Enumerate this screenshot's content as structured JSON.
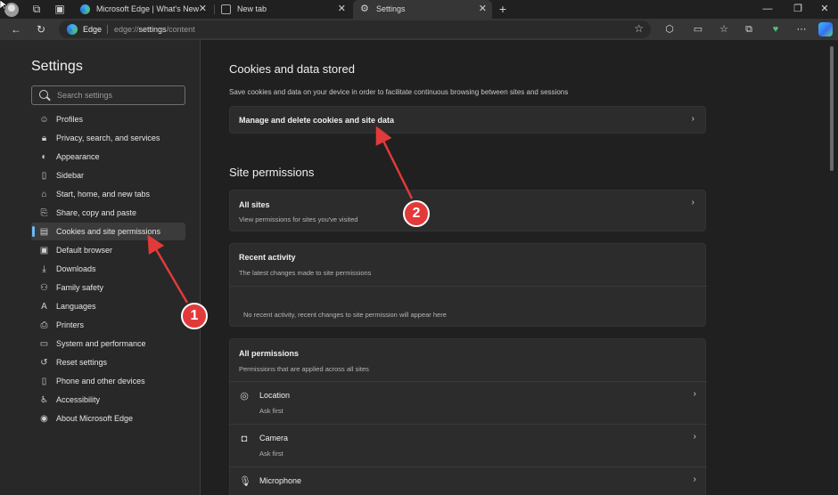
{
  "tabs": [
    {
      "title": "Microsoft Edge | What's New"
    },
    {
      "title": "New tab"
    },
    {
      "title": "Settings"
    }
  ],
  "address": {
    "brand": "Edge",
    "url_prefix": "edge://",
    "url_path": "settings",
    "url_suffix": "/content"
  },
  "sidebar": {
    "title": "Settings",
    "search_placeholder": "Search settings",
    "items": [
      {
        "label": "Profiles",
        "icon": "person-icon"
      },
      {
        "label": "Privacy, search, and services",
        "icon": "lock-icon"
      },
      {
        "label": "Appearance",
        "icon": "paint-icon"
      },
      {
        "label": "Sidebar",
        "icon": "sidebar-icon"
      },
      {
        "label": "Start, home, and new tabs",
        "icon": "home-icon"
      },
      {
        "label": "Share, copy and paste",
        "icon": "share-icon"
      },
      {
        "label": "Cookies and site permissions",
        "icon": "cookie-icon"
      },
      {
        "label": "Default browser",
        "icon": "browser-icon"
      },
      {
        "label": "Downloads",
        "icon": "download-icon"
      },
      {
        "label": "Family safety",
        "icon": "family-icon"
      },
      {
        "label": "Languages",
        "icon": "language-icon"
      },
      {
        "label": "Printers",
        "icon": "printer-icon"
      },
      {
        "label": "System and performance",
        "icon": "laptop-icon"
      },
      {
        "label": "Reset settings",
        "icon": "reset-icon"
      },
      {
        "label": "Phone and other devices",
        "icon": "phone-icon"
      },
      {
        "label": "Accessibility",
        "icon": "accessibility-icon"
      },
      {
        "label": "About Microsoft Edge",
        "icon": "edge-icon"
      }
    ],
    "active_index": 6
  },
  "main": {
    "cookies": {
      "heading": "Cookies and data stored",
      "description": "Save cookies and data on your device in order to facilitate continuous browsing between sites and sessions",
      "manage_label": "Manage and delete cookies and site data"
    },
    "permissions": {
      "heading": "Site permissions",
      "all_sites_title": "All sites",
      "all_sites_sub": "View permissions for sites you've visited",
      "recent_title": "Recent activity",
      "recent_sub": "The latest changes made to site permissions",
      "recent_empty": "No recent activity, recent changes to site permission will appear here",
      "all_perms_title": "All permissions",
      "all_perms_sub": "Permissions that are applied across all sites",
      "location_title": "Location",
      "location_sub": "Ask first",
      "camera_title": "Camera",
      "camera_sub": "Ask first",
      "microphone_title": "Microphone"
    }
  },
  "annotations": {
    "badge1": "1",
    "badge2": "2",
    "color": "#e23a3a"
  }
}
